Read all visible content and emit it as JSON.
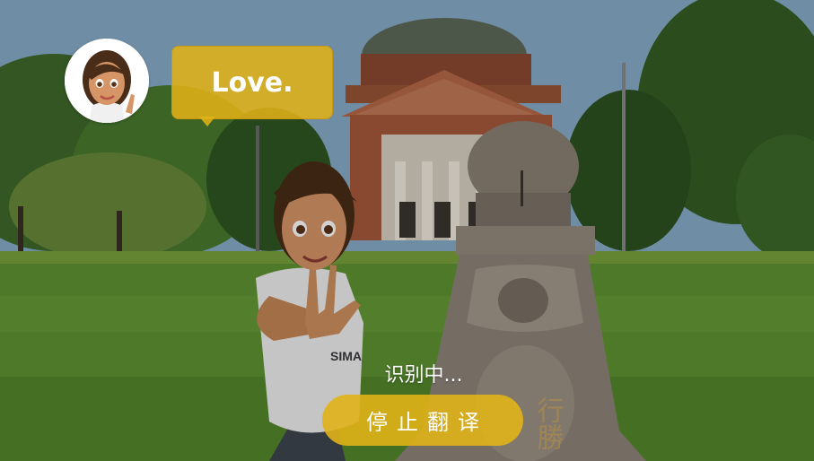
{
  "speech_bubble": {
    "text": "Love."
  },
  "status": {
    "text": "识别中..."
  },
  "stop_button": {
    "label": "停止翻译"
  },
  "shirt_logo": {
    "text": "SIMA"
  },
  "monument": {
    "inscription": "行勝"
  },
  "icons": {
    "avatar": "avatar-icon"
  },
  "colors": {
    "accent": "#e0b218",
    "text": "#ffffff"
  }
}
